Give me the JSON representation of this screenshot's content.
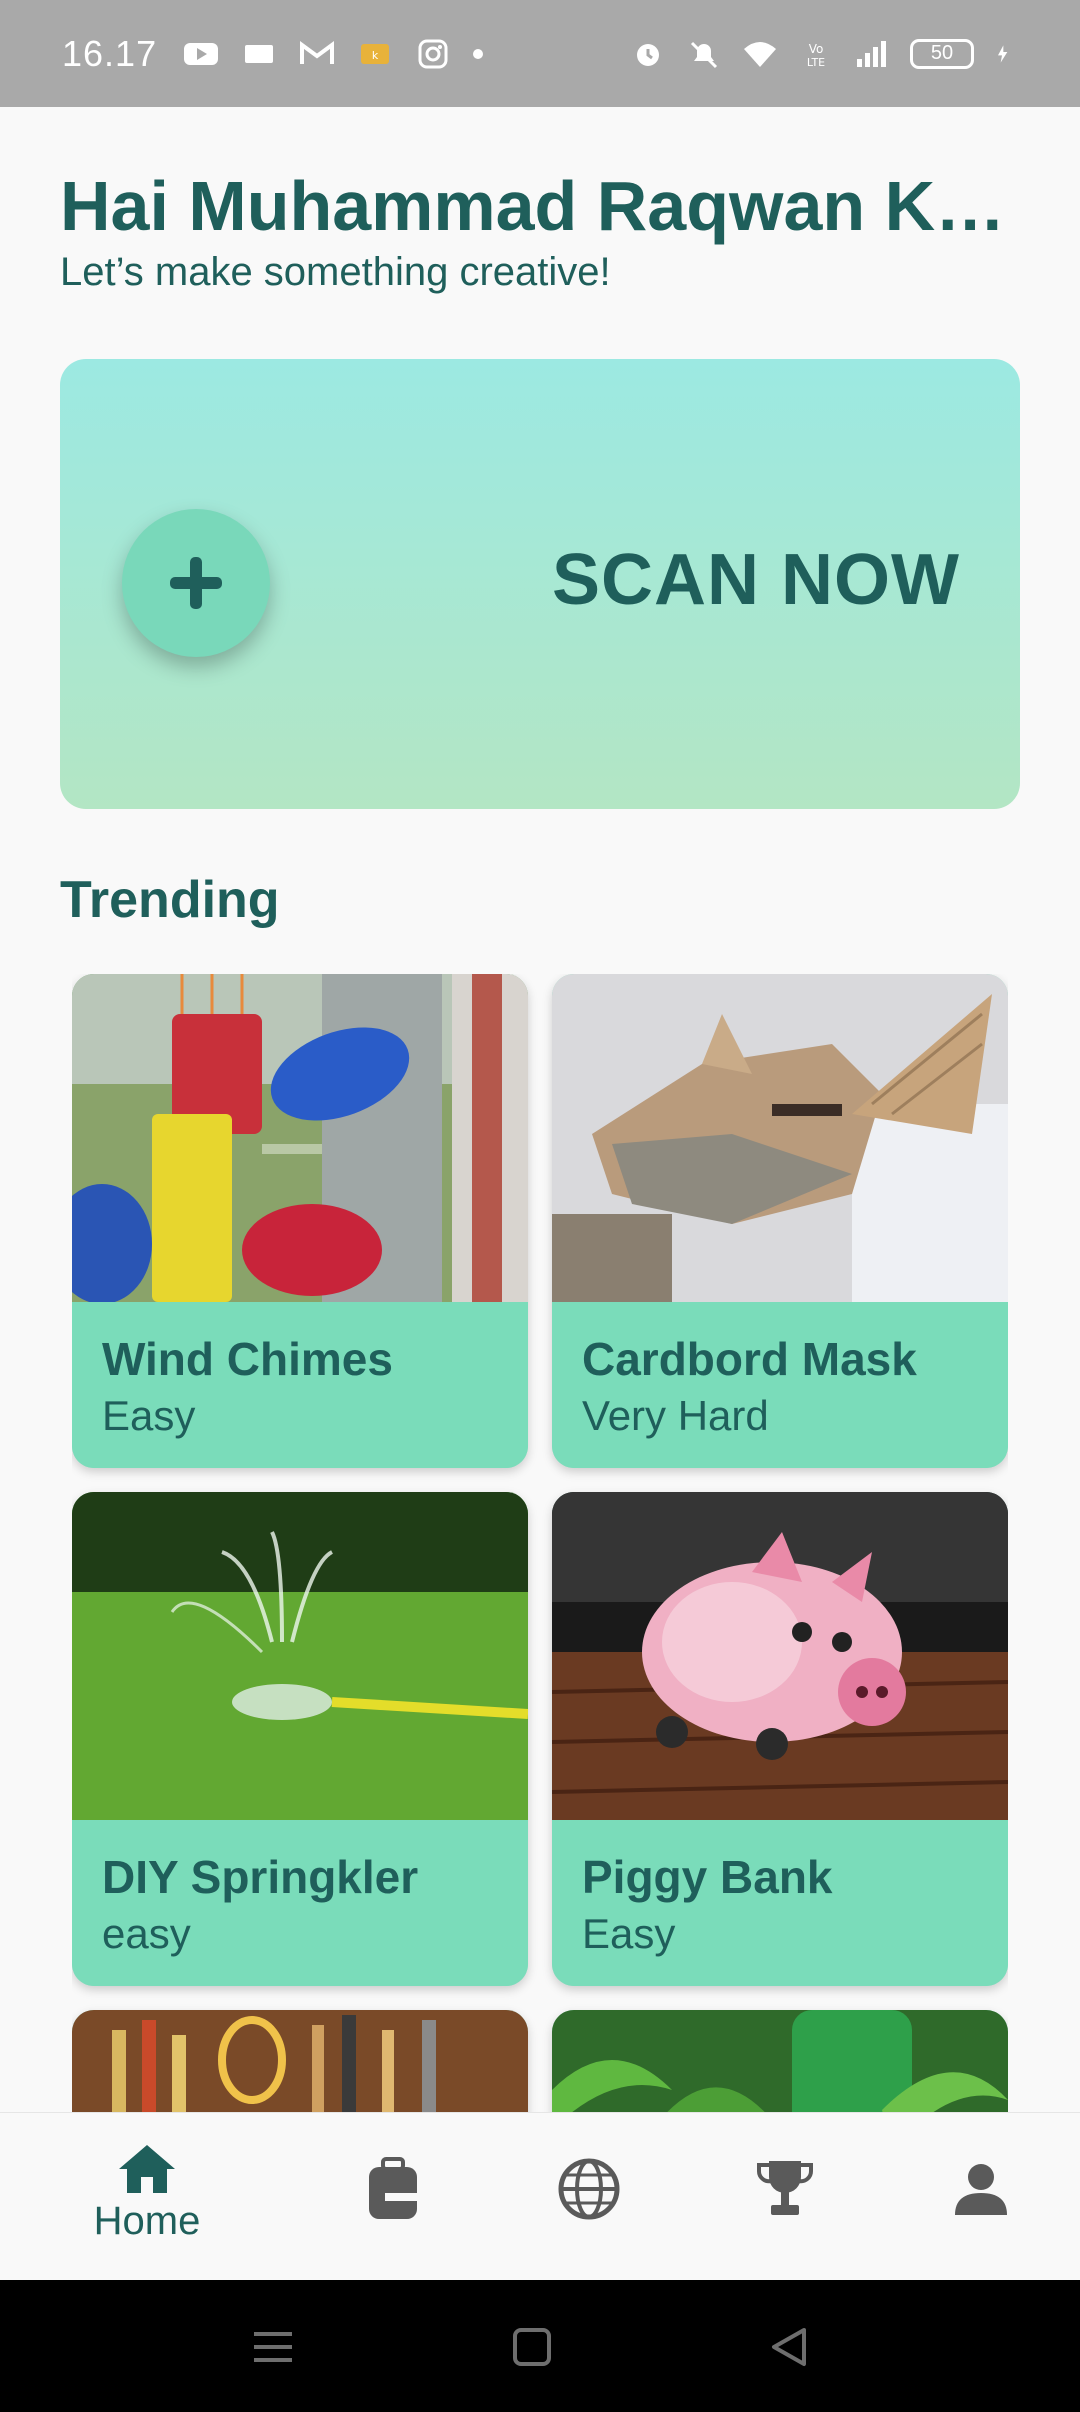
{
  "status_bar": {
    "time": "16.17",
    "battery": "50",
    "left_icons": [
      "youtube-icon",
      "message-icon",
      "gmail-icon",
      "app-icon",
      "instagram-icon",
      "dot-icon"
    ],
    "right_icons": [
      "alarm-icon",
      "mute-icon",
      "wifi-icon",
      "volte-icon",
      "signal-icon",
      "battery-icon",
      "charging-icon"
    ]
  },
  "header": {
    "greeting": "Hai Muhammad Raqwan Ka…",
    "subtitle": "Let’s make something creative!"
  },
  "scan_card": {
    "label": "SCAN NOW",
    "icon": "plus-icon"
  },
  "trending": {
    "title": "Trending",
    "items": [
      {
        "title": "Wind Chimes",
        "level": "Easy"
      },
      {
        "title": "Cardbord Mask",
        "level": "Very Hard"
      },
      {
        "title": "DIY Springkler",
        "level": "easy"
      },
      {
        "title": "Piggy Bank",
        "level": "Easy"
      }
    ]
  },
  "bottom_nav": {
    "items": [
      {
        "icon": "home-icon",
        "label": "Home",
        "active": true
      },
      {
        "icon": "backpack-icon",
        "label": ""
      },
      {
        "icon": "globe-icon",
        "label": ""
      },
      {
        "icon": "trophy-icon",
        "label": ""
      },
      {
        "icon": "profile-icon",
        "label": ""
      }
    ]
  },
  "colors": {
    "primary_text": "#1f5f5b",
    "card_bg": "#7adcba",
    "scan_gradient_top": "#9ce9e2",
    "scan_gradient_bottom": "#b3e6c4",
    "nav_inactive": "#5a5a5a"
  }
}
